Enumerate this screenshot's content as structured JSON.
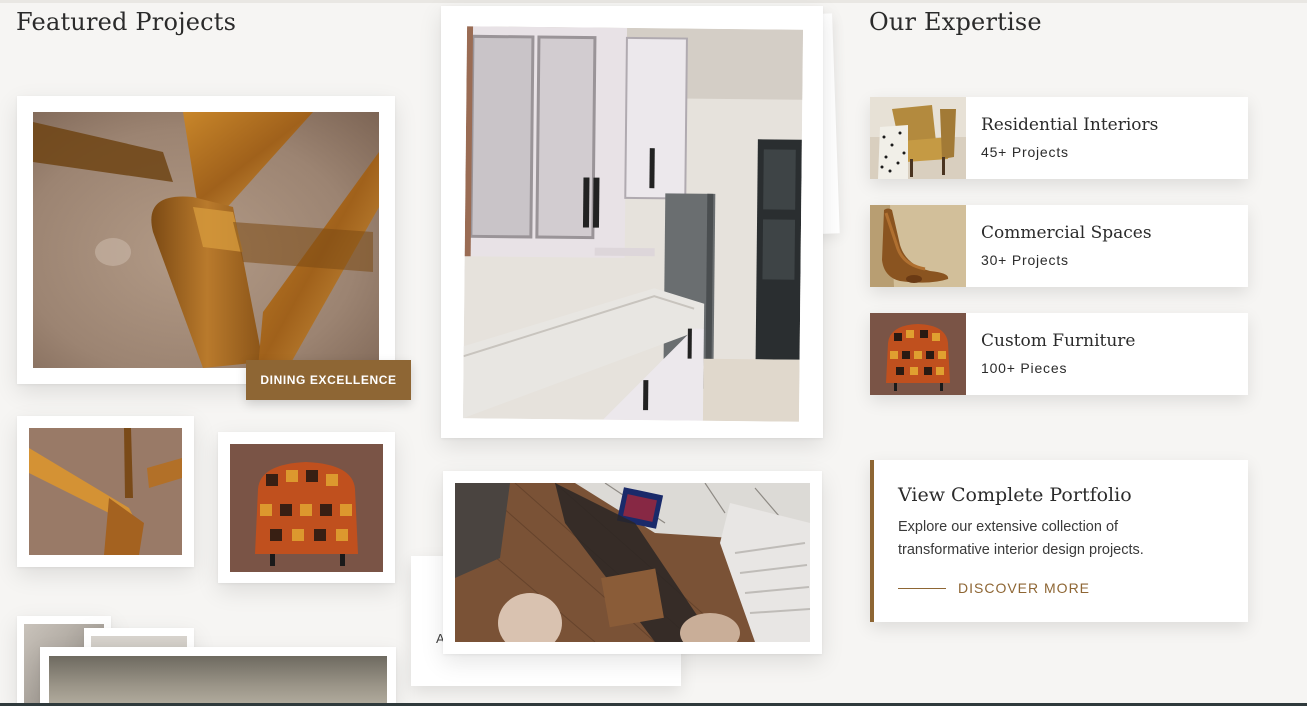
{
  "featured": {
    "title": "Featured Projects",
    "caption": "DINING EXCELLENCE",
    "hidden_card_text": "A"
  },
  "expertise": {
    "title": "Our Expertise",
    "cards": [
      {
        "title": "Residential Interiors",
        "count": "45+ Projects"
      },
      {
        "title": "Commercial Spaces",
        "count": "30+ Projects"
      },
      {
        "title": "Custom Furniture",
        "count": "100+ Pieces"
      }
    ]
  },
  "portfolio": {
    "title": "View Complete Portfolio",
    "description_line1": "Explore our extensive collection of",
    "description_line2": "transformative interior design projects.",
    "link": "DISCOVER MORE"
  },
  "colors": {
    "accent": "#8e6634",
    "background": "#f6f5f3",
    "card": "#ffffff"
  }
}
